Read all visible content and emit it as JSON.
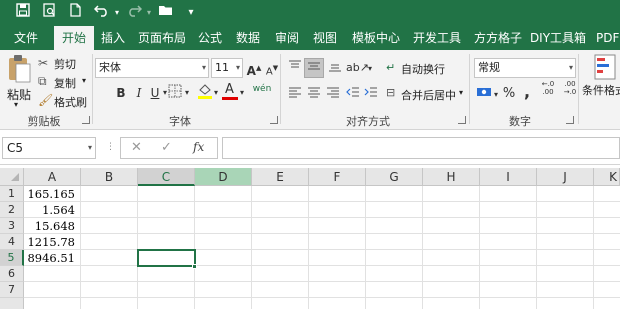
{
  "quick_access": {
    "save_icon": "save-icon",
    "print_preview_icon": "print-preview-icon",
    "new_icon": "new-document-icon",
    "undo_icon": "undo-icon",
    "redo_icon": "redo-icon",
    "open_icon": "open-folder-icon"
  },
  "tabs": [
    {
      "label": "文件"
    },
    {
      "label": "开始"
    },
    {
      "label": "插入"
    },
    {
      "label": "页面布局"
    },
    {
      "label": "公式"
    },
    {
      "label": "数据"
    },
    {
      "label": "审阅"
    },
    {
      "label": "视图"
    },
    {
      "label": "模板中心"
    },
    {
      "label": "开发工具"
    },
    {
      "label": "方方格子"
    },
    {
      "label": "DIY工具箱"
    },
    {
      "label": "PDF"
    }
  ],
  "ribbon": {
    "clipboard": {
      "paste": "粘贴",
      "cut": "剪切",
      "copy": "复制",
      "format_painter": "格式刷",
      "group_label": "剪贴板"
    },
    "font": {
      "font_name": "宋体",
      "font_size": "11",
      "grow": "A",
      "shrink": "A",
      "bold": "B",
      "italic": "I",
      "underline": "U",
      "font_color_glyph": "A",
      "phonetic": "wén",
      "group_label": "字体"
    },
    "alignment": {
      "wrap_text": "自动换行",
      "merge_center": "合并后居中",
      "group_label": "对齐方式"
    },
    "number": {
      "format": "常规",
      "percent": "%",
      "comma": ",",
      "group_label": "数字"
    },
    "styles": {
      "conditional_format": "条件格式"
    }
  },
  "formula_bar": {
    "name_box": "C5",
    "cancel": "✕",
    "enter": "✓",
    "fx": "fx",
    "value": ""
  },
  "grid": {
    "columns": [
      "A",
      "B",
      "C",
      "D",
      "E",
      "F",
      "G",
      "H",
      "I",
      "J",
      "K"
    ],
    "rows": [
      "1",
      "2",
      "3",
      "4",
      "5",
      "6",
      "7"
    ],
    "a_values": [
      "165.165",
      "1.564",
      "15.648",
      "1215.78",
      "8946.51"
    ],
    "selected_cell": "C5",
    "accent_color": "#217346"
  }
}
